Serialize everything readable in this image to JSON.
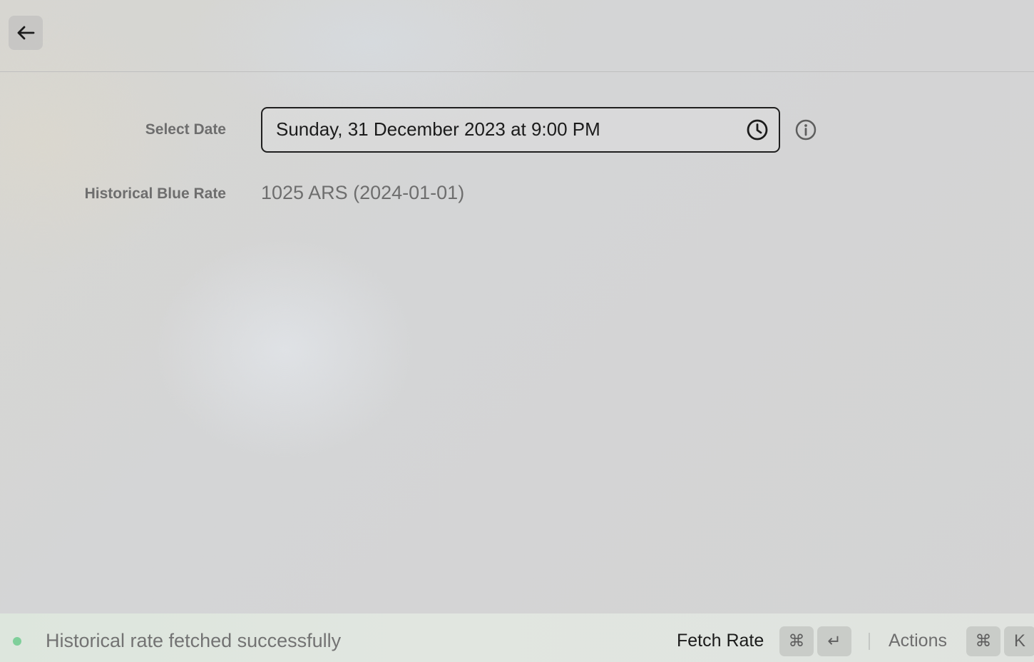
{
  "header": {
    "back_icon": "arrow-left-icon"
  },
  "form": {
    "date_label": "Select Date",
    "date_value": "Sunday, 31 December 2023 at 9:00 PM",
    "date_picker_icon": "clock-icon",
    "info_icon": "info-icon",
    "rate_label": "Historical Blue Rate",
    "rate_value": "1025 ARS (2024-01-01)"
  },
  "footer": {
    "status_text": "Historical rate fetched successfully",
    "status_color": "#7fcf9a",
    "primary_action": "Fetch Rate",
    "primary_shortcut": [
      "⌘",
      "↵"
    ],
    "secondary_action": "Actions",
    "secondary_shortcut": [
      "⌘",
      "K"
    ]
  }
}
